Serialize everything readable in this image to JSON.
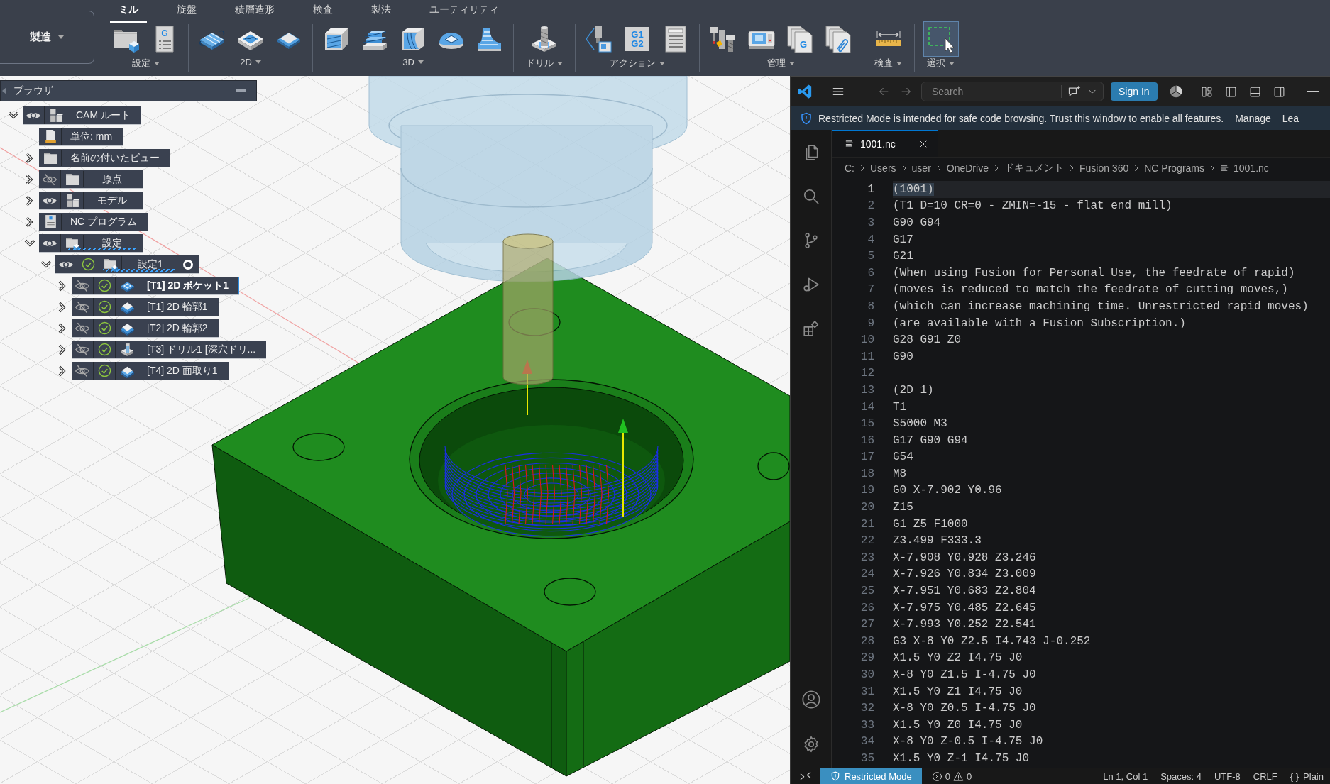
{
  "toolbar": {
    "workspace": "製造",
    "tabs": [
      {
        "label": "ミル",
        "selected": true
      },
      {
        "label": "旋盤",
        "selected": false
      },
      {
        "label": "積層造形",
        "selected": false
      },
      {
        "label": "検査",
        "selected": false
      },
      {
        "label": "製法",
        "selected": false
      },
      {
        "label": "ユーティリティ",
        "selected": false
      }
    ],
    "groups": [
      {
        "label": "設定",
        "tools": [
          {
            "kind": "setup",
            "active": false
          },
          {
            "kind": "nc_program",
            "glyph_lines": [
              "G"
            ],
            "active": false
          }
        ]
      },
      {
        "label": "2D",
        "tools": [
          {
            "kind": "face_2d",
            "active": false
          },
          {
            "kind": "pocket_2d",
            "active": false
          },
          {
            "kind": "chamfer_2d",
            "active": false
          }
        ]
      },
      {
        "label": "3D",
        "tools": [
          {
            "kind": "adaptive_3d",
            "active": false
          },
          {
            "kind": "steep_3d",
            "active": false
          },
          {
            "kind": "flow_3d",
            "active": false
          },
          {
            "kind": "dome_3d",
            "active": false
          },
          {
            "kind": "flare_3d",
            "active": false
          }
        ]
      },
      {
        "label": "ドリル",
        "tools": [
          {
            "kind": "drill",
            "active": false
          }
        ]
      },
      {
        "label": "アクション",
        "tools": [
          {
            "kind": "simulate",
            "active": false
          },
          {
            "kind": "post",
            "glyph_lines": [
              "G1",
              "G2"
            ],
            "active": false
          },
          {
            "kind": "sheet",
            "active": false
          }
        ]
      },
      {
        "label": "管理",
        "tools": [
          {
            "kind": "tool_library",
            "active": false
          },
          {
            "kind": "machine",
            "active": false
          },
          {
            "kind": "nc_programs",
            "glyph_lines": [
              "G"
            ],
            "active": false
          },
          {
            "kind": "templates",
            "active": false
          }
        ]
      },
      {
        "label": "検査",
        "tools": [
          {
            "kind": "measure",
            "active": false
          }
        ]
      },
      {
        "label": "選択",
        "tools": [
          {
            "kind": "select",
            "active": true
          }
        ]
      }
    ]
  },
  "browser": {
    "title": "ブラウザ",
    "tree": [
      {
        "label": "CAM ルート",
        "kind": "root",
        "expanded": true,
        "visible": true,
        "selected": false,
        "children": [
          {
            "label": "単位: mm",
            "kind": "units",
            "selected": false
          },
          {
            "label": "名前の付いたビュー",
            "kind": "folder",
            "expanded": false,
            "selected": false
          },
          {
            "label": "原点",
            "kind": "folder",
            "expanded": false,
            "visible": false,
            "selected": false
          },
          {
            "label": "モデル",
            "kind": "model",
            "expanded": false,
            "visible": true,
            "selected": false
          },
          {
            "label": "NC プログラム",
            "kind": "nc_folder",
            "expanded": false,
            "selected": false
          },
          {
            "label": "設定",
            "kind": "setups",
            "expanded": true,
            "visible": true,
            "marked": true,
            "selected": false,
            "children": [
              {
                "label": "設定1",
                "kind": "setup",
                "expanded": true,
                "visible": true,
                "computed": true,
                "marked": true,
                "active": true,
                "selected": false,
                "children": [
                  {
                    "label": "[T1] 2D ポケット1",
                    "kind": "pocket",
                    "expanded": false,
                    "visible": false,
                    "computed": true,
                    "selected": true
                  },
                  {
                    "label": "[T1] 2D 輪郭1",
                    "kind": "contour",
                    "expanded": false,
                    "visible": false,
                    "computed": true,
                    "selected": false
                  },
                  {
                    "label": "[T2] 2D 輪郭2",
                    "kind": "contour",
                    "expanded": false,
                    "visible": false,
                    "computed": true,
                    "selected": false
                  },
                  {
                    "label": "[T3] ドリル1 [深穴ドリ...",
                    "kind": "drill",
                    "expanded": false,
                    "visible": false,
                    "computed": true,
                    "selected": false
                  },
                  {
                    "label": "[T4] 2D 面取り1",
                    "kind": "chamfer",
                    "expanded": false,
                    "visible": false,
                    "computed": true,
                    "selected": false
                  }
                ]
              }
            ]
          }
        ]
      }
    ]
  },
  "editor": {
    "search": {
      "placeholder": "Search"
    },
    "sign_in": "Sign In",
    "banner": {
      "message": "Restricted Mode is intended for safe code browsing. Trust this window to enable all features.",
      "links": [
        "Manage",
        "Lea"
      ]
    },
    "tabs": [
      {
        "label": "1001.nc",
        "selected": true
      }
    ],
    "breadcrumbs": [
      "C:",
      "Users",
      "user",
      "OneDrive",
      "ドキュメント",
      "Fusion 360",
      "NC Programs",
      "1001.nc"
    ],
    "lines": [
      {
        "number": "1",
        "text": "(1001)",
        "current": true
      },
      {
        "number": "2",
        "text": "(T1 D=10 CR=0 - ZMIN=-15 - flat end mill)",
        "current": false
      },
      {
        "number": "3",
        "text": "G90 G94",
        "current": false
      },
      {
        "number": "4",
        "text": "G17",
        "current": false
      },
      {
        "number": "5",
        "text": "G21",
        "current": false
      },
      {
        "number": "6",
        "text": "(When using Fusion for Personal Use, the feedrate of rapid)",
        "current": false
      },
      {
        "number": "7",
        "text": "(moves is reduced to match the feedrate of cutting moves,)",
        "current": false
      },
      {
        "number": "8",
        "text": "(which can increase machining time. Unrestricted rapid moves)",
        "current": false
      },
      {
        "number": "9",
        "text": "(are available with a Fusion Subscription.)",
        "current": false
      },
      {
        "number": "10",
        "text": "G28 G91 Z0",
        "current": false
      },
      {
        "number": "11",
        "text": "G90",
        "current": false
      },
      {
        "number": "12",
        "current": false
      },
      {
        "number": "13",
        "text": "(2D 1)",
        "current": false
      },
      {
        "number": "14",
        "text": "T1",
        "current": false
      },
      {
        "number": "15",
        "text": "S5000 M3",
        "current": false
      },
      {
        "number": "16",
        "text": "G17 G90 G94",
        "current": false
      },
      {
        "number": "17",
        "text": "G54",
        "current": false
      },
      {
        "number": "18",
        "text": "M8",
        "current": false
      },
      {
        "number": "19",
        "text": "G0 X-7.902 Y0.96",
        "current": false
      },
      {
        "number": "20",
        "text": "Z15",
        "current": false
      },
      {
        "number": "21",
        "text": "G1 Z5 F1000",
        "current": false
      },
      {
        "number": "22",
        "text": "Z3.499 F333.3",
        "current": false
      },
      {
        "number": "23",
        "text": "X-7.908 Y0.928 Z3.246",
        "current": false
      },
      {
        "number": "24",
        "text": "X-7.926 Y0.834 Z3.009",
        "current": false
      },
      {
        "number": "25",
        "text": "X-7.951 Y0.683 Z2.804",
        "current": false
      },
      {
        "number": "26",
        "text": "X-7.975 Y0.485 Z2.645",
        "current": false
      },
      {
        "number": "27",
        "text": "X-7.993 Y0.252 Z2.541",
        "current": false
      },
      {
        "number": "28",
        "text": "G3 X-8 Y0 Z2.5 I4.743 J-0.252",
        "current": false
      },
      {
        "number": "29",
        "text": "X1.5 Y0 Z2 I4.75 J0",
        "current": false
      },
      {
        "number": "30",
        "text": "X-8 Y0 Z1.5 I-4.75 J0",
        "current": false
      },
      {
        "number": "31",
        "text": "X1.5 Y0 Z1 I4.75 J0",
        "current": false
      },
      {
        "number": "32",
        "text": "X-8 Y0 Z0.5 I-4.75 J0",
        "current": false
      },
      {
        "number": "33",
        "text": "X1.5 Y0 Z0 I4.75 J0",
        "current": false
      },
      {
        "number": "34",
        "text": "X-8 Y0 Z-0.5 I-4.75 J0",
        "current": false
      },
      {
        "number": "35",
        "text": "X1.5 Y0 Z-1 I4.75 J0",
        "current": false
      }
    ],
    "status_bar": {
      "mode": "Restricted Mode",
      "errors": "0",
      "warnings": "0",
      "items": [
        "Ln 1, Col 1",
        "Spaces: 4",
        "UTF-8",
        "CRLF"
      ],
      "language_icon": "{ }",
      "language": "Plain"
    }
  }
}
